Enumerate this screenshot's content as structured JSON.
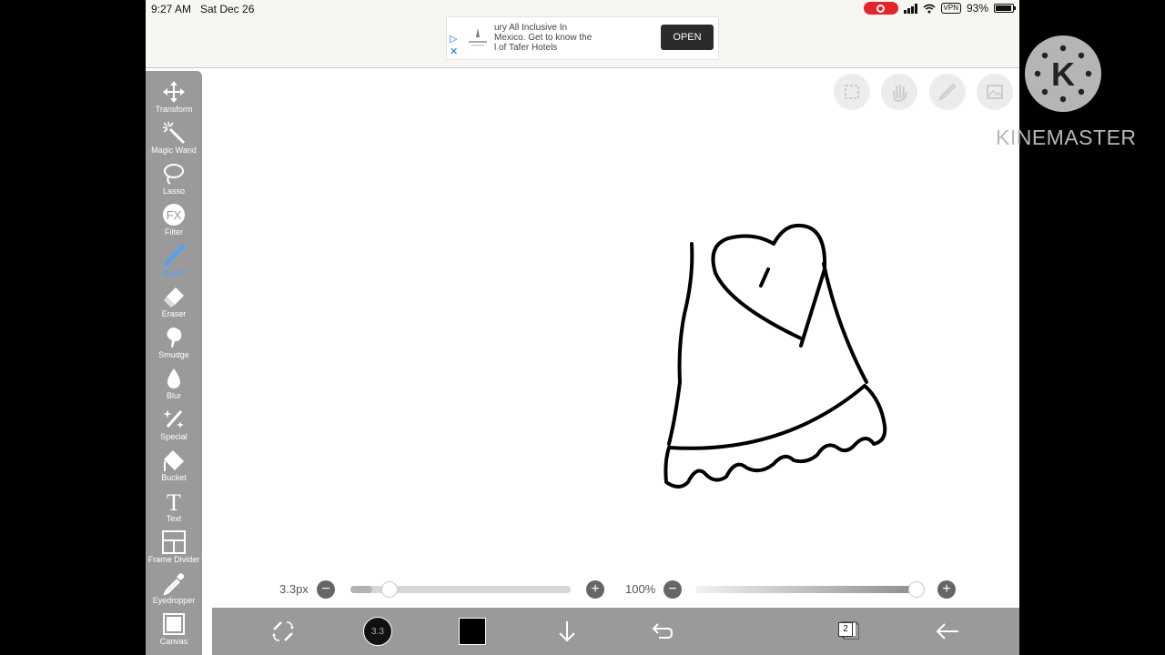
{
  "status_bar": {
    "time": "9:27 AM",
    "date": "Sat Dec 26",
    "battery": "93%",
    "battery_level": 0.93,
    "vpn": "VPN"
  },
  "ad": {
    "line1": "ury All Inclusive In",
    "line2": "Mexico. Get to know the",
    "line3": "l of Tafer Hotels",
    "button": "OPEN"
  },
  "toolbar": {
    "items": [
      {
        "label": "Transform",
        "icon": "move-arrows-icon"
      },
      {
        "label": "Magic Wand",
        "icon": "magic-wand-icon"
      },
      {
        "label": "Lasso",
        "icon": "lasso-icon"
      },
      {
        "label": "Filter",
        "icon": "fx-icon"
      },
      {
        "label": "Brush",
        "icon": "brush-icon",
        "active": true
      },
      {
        "label": "Eraser",
        "icon": "eraser-icon"
      },
      {
        "label": "Smudge",
        "icon": "smudge-icon"
      },
      {
        "label": "Blur",
        "icon": "drop-icon"
      },
      {
        "label": "Special",
        "icon": "sparkle-pen-icon"
      },
      {
        "label": "Bucket",
        "icon": "bucket-icon"
      },
      {
        "label": "Text",
        "icon": "text-icon"
      },
      {
        "label": "Frame Divider",
        "icon": "frame-divider-icon"
      },
      {
        "label": "Eyedropper",
        "icon": "eyedropper-icon"
      },
      {
        "label": "Canvas",
        "icon": "canvas-icon"
      }
    ],
    "active_color": "#4aa3ff"
  },
  "filter_icon_text": "FX",
  "text_tool_glyph": "T",
  "brush_size": {
    "label": "3.3px",
    "fraction": 0.1,
    "preview": "3.3"
  },
  "opacity": {
    "label": "100%",
    "fraction": 1.0
  },
  "minus_glyph": "−",
  "plus_glyph": "+",
  "bottom_bar": {
    "layer_count": "2",
    "color": "#000000"
  },
  "watermark": {
    "letter": "K",
    "wordmark": "KINEMASTER"
  }
}
